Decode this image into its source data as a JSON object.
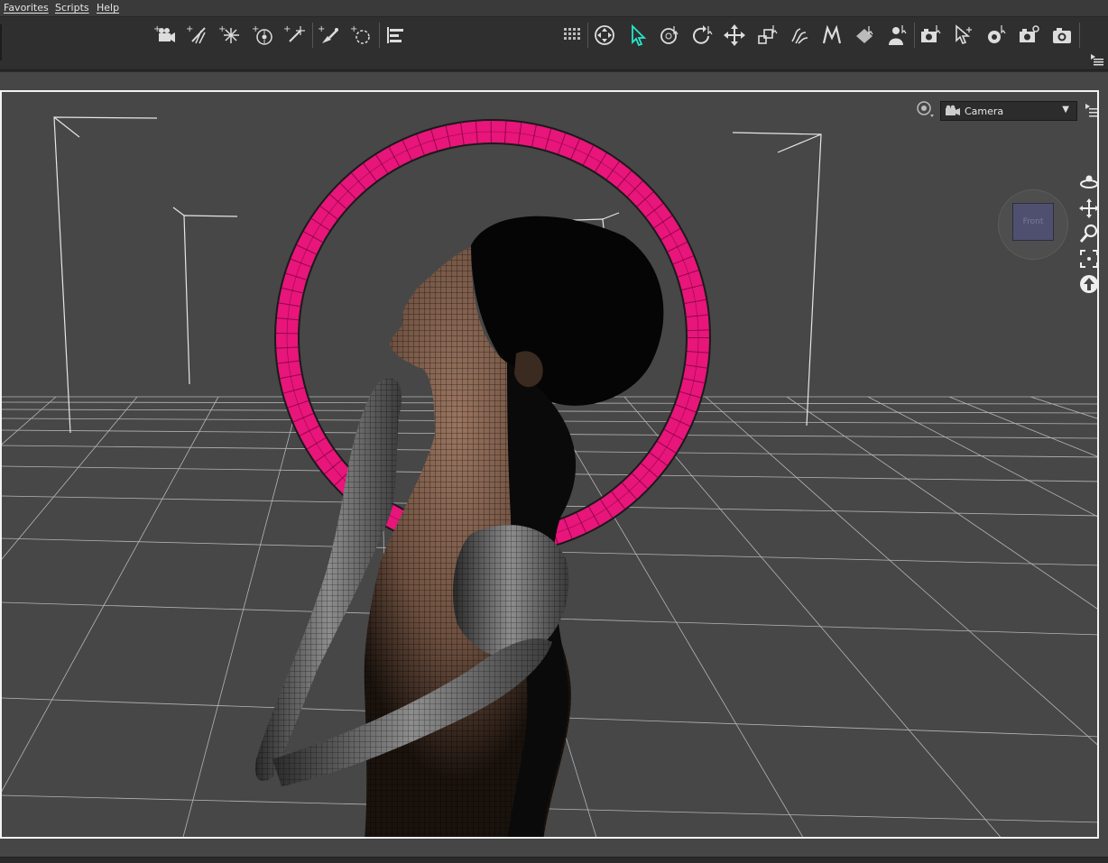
{
  "menubar": {
    "items": [
      {
        "label": "Favorites"
      },
      {
        "label": "Scripts"
      },
      {
        "label": "Help"
      }
    ]
  },
  "toolbar": {
    "left_group": [
      {
        "icon": "new-camera-icon"
      },
      {
        "icon": "new-spotlight-icon"
      },
      {
        "icon": "new-distant-light-icon"
      },
      {
        "icon": "new-point-light-icon"
      },
      {
        "icon": "new-linear-point-light-icon"
      },
      {
        "icon": "node-weight-map-brush-icon"
      },
      {
        "icon": "new-null-icon"
      },
      {
        "icon": "align-icon"
      }
    ],
    "right_group": [
      {
        "icon": "render-preview-grid-icon"
      },
      {
        "icon": "universal-tool-icon"
      },
      {
        "icon": "node-selection-tool-icon",
        "active": true
      },
      {
        "icon": "rotate-tool-icon"
      },
      {
        "icon": "rotate-tool-2-icon"
      },
      {
        "icon": "translate-tool-icon"
      },
      {
        "icon": "scale-tool-icon"
      },
      {
        "icon": "joint-editor-icon"
      },
      {
        "icon": "surface-selection-icon"
      },
      {
        "icon": "geometry-editor-icon"
      },
      {
        "icon": "figure-selection-icon"
      },
      {
        "icon": "spot-render-icon"
      },
      {
        "icon": "active-pose-tool-icon"
      },
      {
        "icon": "render-settings-icon"
      },
      {
        "icon": "render-camera-icon"
      },
      {
        "icon": "render-icon"
      }
    ]
  },
  "viewport": {
    "camera_label": "Camera",
    "nav_cube_label": "Front",
    "colors": {
      "background": "#474747",
      "grid": "#bfbfbf",
      "halo": "#e8157a",
      "skin": "#8a6a55",
      "frame": "#f2f2f2"
    }
  },
  "nav_tools": [
    {
      "icon": "orbit-icon"
    },
    {
      "icon": "pan-icon"
    },
    {
      "icon": "zoom-icon"
    },
    {
      "icon": "frame-icon"
    },
    {
      "icon": "reset-view-icon"
    }
  ]
}
